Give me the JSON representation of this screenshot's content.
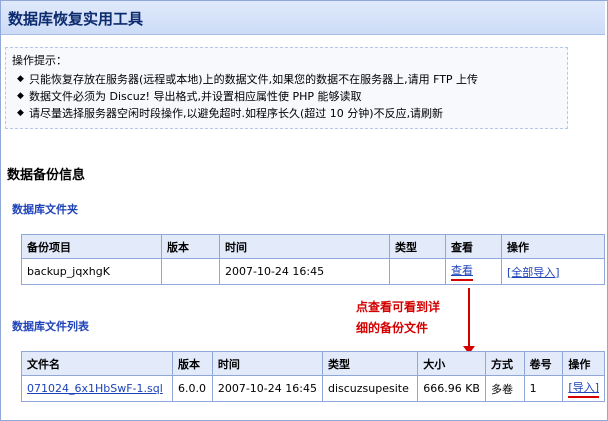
{
  "header": {
    "title": "数据库恢复实用工具"
  },
  "tips": {
    "title": "操作提示：",
    "items": [
      "只能恢复存放在服务器(远程或本地)上的数据文件,如果您的数据不在服务器上,请用 FTP 上传",
      "数据文件必须为 Discuz! 导出格式,并设置相应属性使 PHP 能够读取",
      "请尽量选择服务器空闲时段操作,以避免超时.如程序长久(超过 10 分钟)不反应,请刷新"
    ]
  },
  "section_title": "数据备份信息",
  "folder": {
    "title": "数据库文件夹",
    "headers": [
      "备份项目",
      "版本",
      "时间",
      "类型",
      "查看",
      "操作"
    ],
    "row": {
      "name": "backup_jqxhgK",
      "version": "",
      "time": "2007-10-24 16:45",
      "type": "",
      "view": "查看",
      "action": "[全部导入]"
    }
  },
  "files": {
    "title": "数据库文件列表",
    "headers": [
      "文件名",
      "版本",
      "时间",
      "类型",
      "大小",
      "方式",
      "卷号",
      "操作"
    ],
    "row": {
      "filename": "071024_6x1HbSwF-1.sql",
      "version": "6.0.0",
      "time": "2007-10-24 16:45",
      "type": "discuzsupesite",
      "size": "666.96 KB",
      "mode": "多卷",
      "volume": "1",
      "action": "[导入]"
    }
  },
  "callout": {
    "line1": "点查看可看到详",
    "line2": "细的备份文件"
  },
  "colors": {
    "accent": "#1f43b8",
    "annotation": "#d40000",
    "border": "#8fa8d8"
  }
}
